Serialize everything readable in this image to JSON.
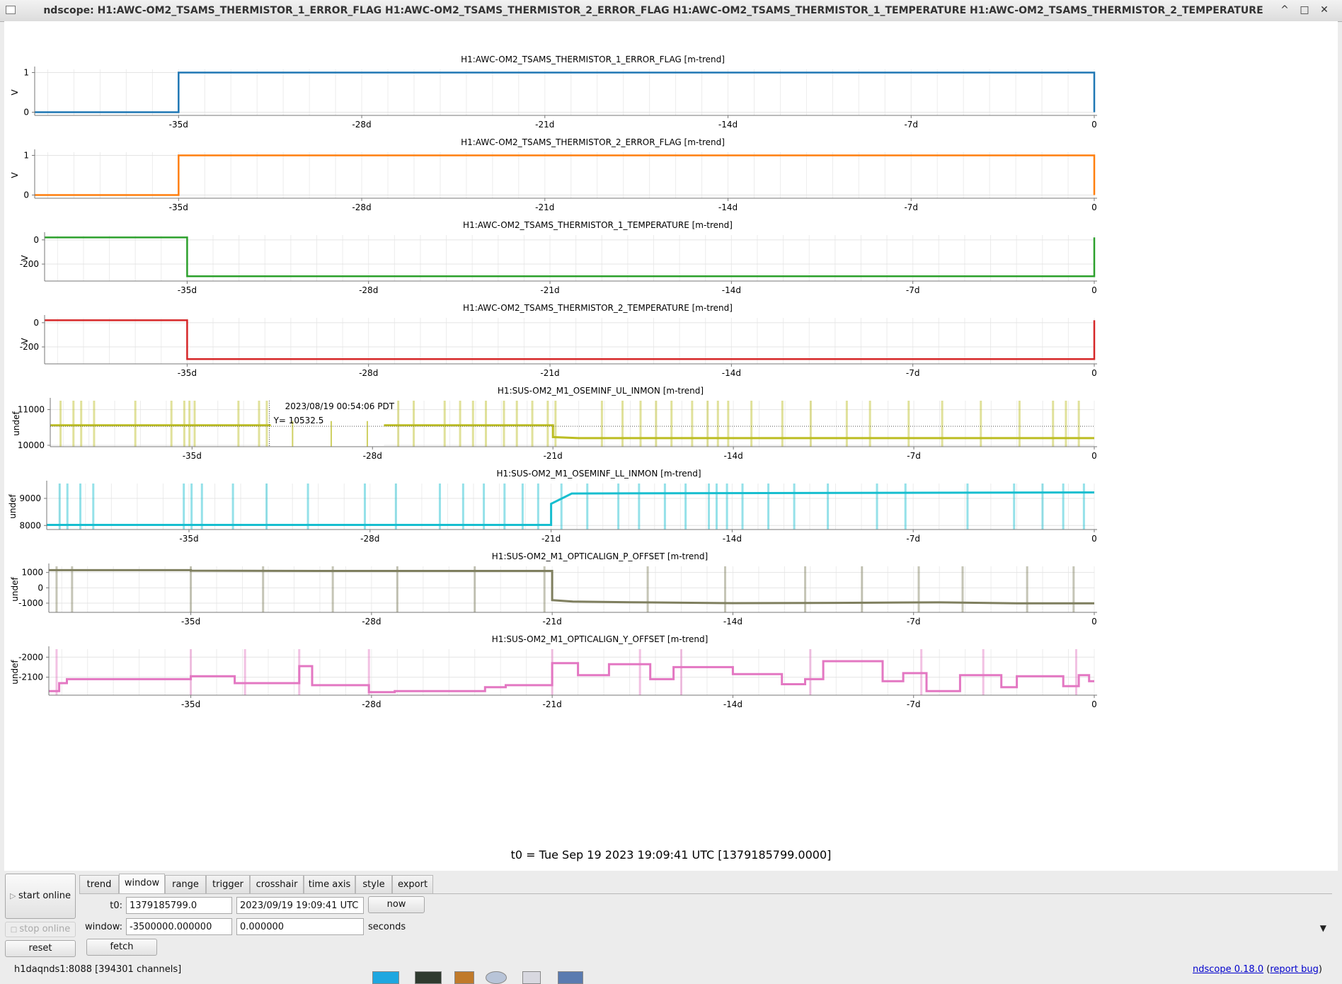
{
  "window": {
    "title": "ndscope: H1:AWC-OM2_TSAMS_THERMISTOR_1_ERROR_FLAG H1:AWC-OM2_TSAMS_THERMISTOR_2_ERROR_FLAG H1:AWC-OM2_TSAMS_THERMISTOR_1_TEMPERATURE H1:AWC-OM2_TSAMS_THERMISTOR_2_TEMPERATURE",
    "controls": [
      "^",
      "□",
      "✕"
    ]
  },
  "x_axis": {
    "ticks": [
      "-35d",
      "-28d",
      "-21d",
      "-14d",
      "-7d",
      "0"
    ],
    "tick_values": [
      -35,
      -28,
      -21,
      -14,
      -7,
      0
    ],
    "range_days": [
      -40.5,
      0
    ]
  },
  "plots": [
    {
      "title": "H1:AWC-OM2_TSAMS_THERMISTOR_1_ERROR_FLAG [m-trend]",
      "ylabel": "V",
      "color": "#1f77b4",
      "ylim": [
        -0.08,
        1.08
      ],
      "yticks": [
        {
          "v": 0,
          "label": "0"
        },
        {
          "v": 1,
          "label": "1"
        }
      ],
      "series": [
        [
          -40.5,
          0
        ],
        [
          -35,
          0
        ],
        [
          -35,
          1
        ],
        [
          0,
          1
        ],
        [
          0,
          0
        ]
      ]
    },
    {
      "title": "H1:AWC-OM2_TSAMS_THERMISTOR_2_ERROR_FLAG [m-trend]",
      "ylabel": "V",
      "color": "#ff7f0e",
      "ylim": [
        -0.08,
        1.08
      ],
      "yticks": [
        {
          "v": 0,
          "label": "0"
        },
        {
          "v": 1,
          "label": "1"
        }
      ],
      "series": [
        [
          -40.5,
          0
        ],
        [
          -35,
          0
        ],
        [
          -35,
          1
        ],
        [
          0,
          1
        ],
        [
          0,
          0
        ]
      ]
    },
    {
      "title": "H1:AWC-OM2_TSAMS_THERMISTOR_1_TEMPERATURE [m-trend]",
      "ylabel": "V",
      "color": "#2ca02c",
      "ylim": [
        -340,
        40
      ],
      "yticks": [
        {
          "v": 0,
          "label": "0"
        },
        {
          "v": -200,
          "label": "-200"
        }
      ],
      "series": [
        [
          -40.5,
          20
        ],
        [
          -35,
          20
        ],
        [
          -35,
          -300
        ],
        [
          0,
          -300
        ],
        [
          0,
          20
        ]
      ]
    },
    {
      "title": "H1:AWC-OM2_TSAMS_THERMISTOR_2_TEMPERATURE [m-trend]",
      "ylabel": "V",
      "color": "#d62728",
      "ylim": [
        -340,
        40
      ],
      "yticks": [
        {
          "v": 0,
          "label": "0"
        },
        {
          "v": -200,
          "label": "-200"
        }
      ],
      "series": [
        [
          -40.5,
          20
        ],
        [
          -35,
          20
        ],
        [
          -35,
          -300
        ],
        [
          0,
          -300
        ],
        [
          0,
          20
        ]
      ]
    },
    {
      "title": "H1:SUS-OM2_M1_OSEMINF_UL_INMON [m-trend]",
      "ylabel": "undef",
      "color": "#bcbd22",
      "ylim": [
        9960,
        11250
      ],
      "yticks": [
        {
          "v": 11000,
          "label": "11000"
        },
        {
          "v": 10000,
          "label": "10000"
        }
      ],
      "series": [
        [
          -40.5,
          10560
        ],
        [
          -32,
          10560
        ],
        [
          -27.5,
          10560
        ],
        [
          -21,
          10560
        ],
        [
          -21,
          10230
        ],
        [
          -20,
          10200
        ],
        [
          0,
          10200
        ]
      ],
      "gaps": [
        [
          -32,
          -27.5
        ]
      ],
      "spikes": [
        -40.1,
        -39.6,
        -39.3,
        -38.8,
        -37.2,
        -35.8,
        -35.3,
        -35.1,
        -34.9,
        -33.2,
        -32.4,
        -32.1,
        -27.0,
        -26.4,
        -25.2,
        -24.6,
        -24.1,
        -23.6,
        -22.9,
        -22.4,
        -21.8,
        -21.2,
        -20.9,
        -19.1,
        -18.3,
        -17.6,
        -17.0,
        -16.4,
        -15.6,
        -15.0,
        -14.6,
        -14.2,
        -13.3,
        -12.1,
        -11.0,
        -9.6,
        -8.7,
        -7.2,
        -5.9,
        -4.4,
        -2.9,
        -1.6,
        -1.1,
        -0.6
      ],
      "cursor": {
        "x": -32.0,
        "y": 10532.5,
        "time_label": "2023/08/19 00:54:06 PDT",
        "y_label": "Y= 10532.5"
      }
    },
    {
      "title": "H1:SUS-OM2_M1_OSEMINF_LL_INMON [m-trend]",
      "ylabel": "undef",
      "color": "#17becf",
      "ylim": [
        7850,
        9550
      ],
      "yticks": [
        {
          "v": 9000,
          "label": "9000"
        },
        {
          "v": 8000,
          "label": "8000"
        }
      ],
      "series": [
        [
          -40.5,
          8020
        ],
        [
          -21,
          8020
        ],
        [
          -21,
          8800
        ],
        [
          -20.2,
          9180
        ],
        [
          0,
          9220
        ]
      ],
      "spikes": [
        -40.0,
        -39.7,
        -39.2,
        -38.7,
        -35.2,
        -34.9,
        -34.5,
        -33.3,
        -32.0,
        -30.4,
        -28.2,
        -27.0,
        -25.3,
        -24.4,
        -23.6,
        -22.8,
        -22.1,
        -21.5,
        -20.6,
        -19.6,
        -18.4,
        -17.6,
        -16.6,
        -15.8,
        -14.9,
        -14.6,
        -14.2,
        -13.6,
        -12.6,
        -11.6,
        -10.3,
        -8.4,
        -7.3,
        -4.9,
        -3.1,
        -2.0,
        -1.2,
        -0.4
      ],
      "low_spike_value": 7850
    },
    {
      "title": "H1:SUS-OM2_M1_OPTICALIGN_P_OFFSET [m-trend]",
      "ylabel": "undef",
      "color": "#7f7f5f",
      "ylim": [
        -1600,
        1400
      ],
      "yticks": [
        {
          "v": 1000,
          "label": "1000"
        },
        {
          "v": 0,
          "label": "0"
        },
        {
          "v": -1000,
          "label": "-1000"
        }
      ],
      "series": [
        [
          -40.5,
          1150
        ],
        [
          -35,
          1150
        ],
        [
          -35,
          1120
        ],
        [
          -30,
          1100
        ],
        [
          -21,
          1100
        ],
        [
          -21,
          -800
        ],
        [
          -20.2,
          -900
        ],
        [
          -17.5,
          -950
        ],
        [
          -14,
          -1000
        ],
        [
          -10,
          -980
        ],
        [
          -6,
          -950
        ],
        [
          -3,
          -1010
        ],
        [
          0,
          -1010
        ]
      ],
      "spikes": [
        -40.2,
        -39.6,
        -35.0,
        -32.2,
        -29.5,
        -27.0,
        -24.0,
        -21.3,
        -17.3,
        -14.3,
        -11.2,
        -9.0,
        -6.8,
        -5.1,
        -2.6,
        -0.8
      ]
    },
    {
      "title": "H1:SUS-OM2_M1_OPTICALIGN_Y_OFFSET [m-trend]",
      "ylabel": "undef",
      "color": "#e377c2",
      "ylim": [
        -2190,
        -1960
      ],
      "yticks": [
        {
          "v": -2000,
          "label": "-2000"
        },
        {
          "v": -2100,
          "label": "-2100"
        }
      ],
      "series": [
        [
          -40.5,
          -2170
        ],
        [
          -40.1,
          -2170
        ],
        [
          -40.1,
          -2130
        ],
        [
          -39.8,
          -2130
        ],
        [
          -39.8,
          -2110
        ],
        [
          -35.0,
          -2110
        ],
        [
          -35.0,
          -2095
        ],
        [
          -33.3,
          -2095
        ],
        [
          -33.3,
          -2130
        ],
        [
          -30.8,
          -2130
        ],
        [
          -30.8,
          -2045
        ],
        [
          -30.3,
          -2045
        ],
        [
          -30.3,
          -2140
        ],
        [
          -28.1,
          -2140
        ],
        [
          -28.1,
          -2175
        ],
        [
          -27.1,
          -2175
        ],
        [
          -27.1,
          -2170
        ],
        [
          -23.6,
          -2170
        ],
        [
          -23.6,
          -2150
        ],
        [
          -22.8,
          -2150
        ],
        [
          -22.8,
          -2140
        ],
        [
          -21.0,
          -2140
        ],
        [
          -21.0,
          -2030
        ],
        [
          -20.0,
          -2030
        ],
        [
          -20.0,
          -2090
        ],
        [
          -18.8,
          -2090
        ],
        [
          -18.8,
          -2035
        ],
        [
          -17.2,
          -2035
        ],
        [
          -17.2,
          -2110
        ],
        [
          -16.3,
          -2110
        ],
        [
          -16.3,
          -2050
        ],
        [
          -14.0,
          -2050
        ],
        [
          -14.0,
          -2085
        ],
        [
          -12.1,
          -2085
        ],
        [
          -12.1,
          -2135
        ],
        [
          -11.2,
          -2135
        ],
        [
          -11.2,
          -2110
        ],
        [
          -10.5,
          -2110
        ],
        [
          -10.5,
          -2020
        ],
        [
          -8.2,
          -2020
        ],
        [
          -8.2,
          -2120
        ],
        [
          -7.4,
          -2120
        ],
        [
          -7.4,
          -2080
        ],
        [
          -6.5,
          -2080
        ],
        [
          -6.5,
          -2170
        ],
        [
          -5.2,
          -2170
        ],
        [
          -5.2,
          -2090
        ],
        [
          -3.6,
          -2090
        ],
        [
          -3.6,
          -2150
        ],
        [
          -3.0,
          -2150
        ],
        [
          -3.0,
          -2095
        ],
        [
          -1.2,
          -2095
        ],
        [
          -1.2,
          -2145
        ],
        [
          -0.6,
          -2145
        ],
        [
          -0.6,
          -2090
        ],
        [
          -0.2,
          -2090
        ],
        [
          -0.2,
          -2120
        ],
        [
          0,
          -2120
        ]
      ],
      "spikes": [
        -40.2,
        -35.0,
        -32.9,
        -30.8,
        -28.1,
        -21.0,
        -17.6,
        -16.0,
        -11.0,
        -6.7,
        -4.3,
        -0.7
      ]
    }
  ],
  "t0_label": "t0 = Tue Sep 19 2023 19:09:41 UTC [1379185799.0000]",
  "controls": {
    "start_online": "start online",
    "stop_online": "stop online",
    "reset": "reset",
    "tabs": [
      "trend",
      "window",
      "range",
      "trigger",
      "crosshair",
      "time axis",
      "style",
      "export"
    ],
    "active_tab": "window",
    "t0_label": "t0:",
    "t0_gps": "1379185799.0",
    "t0_utc": "2023/09/19 19:09:41 UTC",
    "now": "now",
    "window_label": "window:",
    "window_start": "-3500000.000000",
    "window_end": "0.000000",
    "seconds_label": "seconds",
    "fetch": "fetch",
    "more_icon": "▼"
  },
  "status": {
    "server": "h1daqnds1:8088  [394301 channels]",
    "version_link": "ndscope 0.18.0",
    "paren_open": " (",
    "report_link": "report bug",
    "paren_close": ")"
  }
}
